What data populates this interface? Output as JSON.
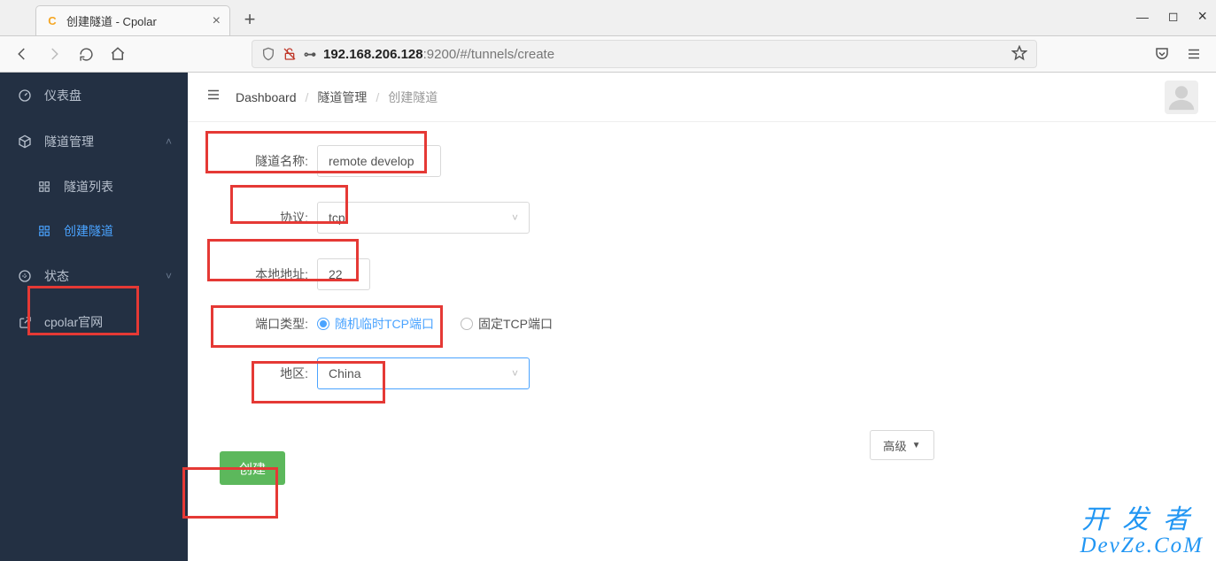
{
  "browser": {
    "tab_favicon": "C",
    "tab_title": "创建隧道 - Cpolar",
    "url_host": "192.168.206.128",
    "url_rest": ":9200/#/tunnels/create"
  },
  "sidebar": {
    "items": [
      {
        "label": "仪表盘"
      },
      {
        "label": "隧道管理"
      },
      {
        "label": "隧道列表"
      },
      {
        "label": "创建隧道"
      },
      {
        "label": "状态"
      },
      {
        "label": "cpolar官网"
      }
    ]
  },
  "breadcrumb": {
    "root": "Dashboard",
    "mid": "隧道管理",
    "leaf": "创建隧道"
  },
  "form": {
    "tunnel_name_label": "隧道名称:",
    "tunnel_name_value": "remote develop",
    "protocol_label": "协议:",
    "protocol_value": "tcp",
    "local_addr_label": "本地地址:",
    "local_addr_value": "22",
    "port_type_label": "端口类型:",
    "port_type_options": [
      "随机临时TCP端口",
      "固定TCP端口"
    ],
    "region_label": "地区:",
    "region_value": "China",
    "advanced_label": "高级",
    "submit_label": "创建"
  },
  "watermark": {
    "line1": "开发者",
    "line2": "DevZe.CoM"
  }
}
